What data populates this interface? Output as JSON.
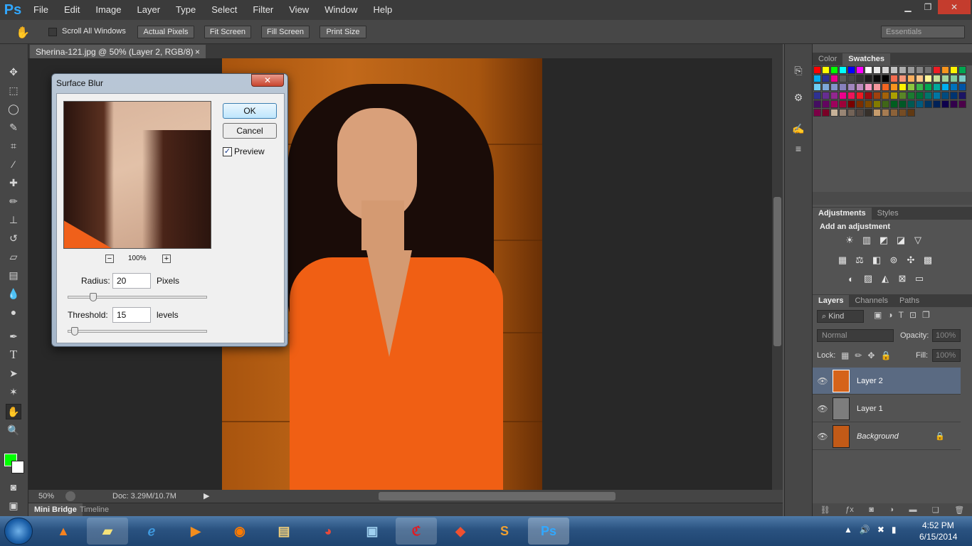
{
  "app": {
    "logo": "Ps"
  },
  "menu": [
    "File",
    "Edit",
    "Image",
    "Layer",
    "Type",
    "Select",
    "Filter",
    "View",
    "Window",
    "Help"
  ],
  "window_buttons": {
    "minimize": "▁",
    "restore": "❐",
    "close": "✕"
  },
  "options": {
    "hand_icon": "hand-icon",
    "scroll_all": "Scroll All Windows",
    "actual_pixels": "Actual Pixels",
    "fit_screen": "Fit Screen",
    "fill_screen": "Fill Screen",
    "print_size": "Print Size",
    "workspace": "Essentials"
  },
  "document": {
    "tab_title": "Sherina-121.jpg @ 50% (Layer 2, RGB/8) *",
    "close": "×"
  },
  "status": {
    "zoom": "50%",
    "doc": "Doc: 3.29M/10.7M"
  },
  "bottom_tabs": {
    "mini_bridge": "Mini Bridge",
    "timeline": "Timeline"
  },
  "panels": {
    "color_tabs": [
      "Color",
      "Swatches"
    ],
    "adjust_tabs": [
      "Adjustments",
      "Styles"
    ],
    "add_adjustment": "Add an adjustment",
    "layers_tabs": [
      "Layers",
      "Channels",
      "Paths"
    ],
    "kind": "Kind",
    "blend_mode": "Normal",
    "opacity_label": "Opacity:",
    "opacity_value": "100%",
    "lock_label": "Lock:",
    "fill_label": "Fill:",
    "fill_value": "100%",
    "layers": [
      {
        "name": "Layer 2",
        "selected": true
      },
      {
        "name": "Layer 1",
        "selected": false
      },
      {
        "name": "Background",
        "selected": false
      }
    ]
  },
  "dialog": {
    "title": "Surface Blur",
    "ok": "OK",
    "cancel": "Cancel",
    "preview_label": "Preview",
    "preview_checked": true,
    "zoom": "100%",
    "radius_label": "Radius:",
    "radius_value": "20",
    "radius_unit": "Pixels",
    "threshold_label": "Threshold:",
    "threshold_value": "15",
    "threshold_unit": "levels"
  },
  "taskbar": {
    "time": "4:52 PM",
    "date": "6/15/2014"
  },
  "swatch_colors": [
    "#ff0000",
    "#ffff00",
    "#00ff00",
    "#00ffff",
    "#0000ff",
    "#ff00ff",
    "#ffffff",
    "#ebebeb",
    "#d6d6d6",
    "#c2c2c2",
    "#adadad",
    "#999999",
    "#858585",
    "#707070",
    "#ee1d24",
    "#f7941d",
    "#fff200",
    "#00a651",
    "#00aeef",
    "#2e3192",
    "#ec008c",
    "#5c5c5c",
    "#474747",
    "#333333",
    "#1f1f1f",
    "#0a0a0a",
    "#000000",
    "#f26c4f",
    "#f69679",
    "#fbaf5d",
    "#fdc68a",
    "#fff799",
    "#c4df9b",
    "#a3d39c",
    "#82ca9c",
    "#7accc8",
    "#6dcff6",
    "#7da7d9",
    "#8493ca",
    "#8781bd",
    "#a186be",
    "#bd8cbf",
    "#f49ac1",
    "#f5989d",
    "#f26522",
    "#f7941d",
    "#fff200",
    "#8dc63f",
    "#39b54a",
    "#00a651",
    "#00a99d",
    "#00aeef",
    "#0072bc",
    "#0054a6",
    "#2e3192",
    "#662d91",
    "#92278f",
    "#ec008c",
    "#ed145b",
    "#ed1c24",
    "#9e0b0f",
    "#a0410d",
    "#a36209",
    "#aba000",
    "#598527",
    "#1a7b30",
    "#007236",
    "#00746b",
    "#0076a3",
    "#004b80",
    "#003471",
    "#1b1464",
    "#440e62",
    "#630460",
    "#9e005d",
    "#9e0039",
    "#790000",
    "#7b2e00",
    "#7d4900",
    "#827b00",
    "#406618",
    "#005e20",
    "#005826",
    "#005952",
    "#005b7f",
    "#003663",
    "#002157",
    "#0d004c",
    "#32004b",
    "#4b0049",
    "#7b0046",
    "#7a0026",
    "#c7b299",
    "#998675",
    "#736357",
    "#534741",
    "#37302a",
    "#c69c6d",
    "#a67c52",
    "#8c6239",
    "#754c24",
    "#603913"
  ]
}
